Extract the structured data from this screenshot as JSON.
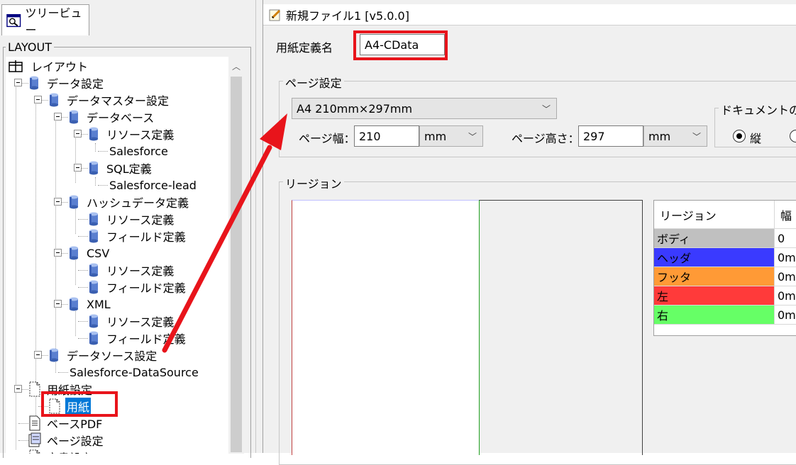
{
  "left": {
    "tab_label": "ツリービュー",
    "group_label": "LAYOUT",
    "tree": [
      {
        "label": "レイアウト",
        "icon": "layout-icon",
        "depth": 0
      },
      {
        "label": "データ設定",
        "icon": "database-icon",
        "depth": 1,
        "expanded": true
      },
      {
        "label": "データマスター設定",
        "icon": "database-icon",
        "depth": 2,
        "expanded": true
      },
      {
        "label": "データベース",
        "icon": "database-icon",
        "depth": 3,
        "expanded": true
      },
      {
        "label": "リソース定義",
        "icon": "database-icon",
        "depth": 4,
        "expanded": true
      },
      {
        "label": "Salesforce",
        "icon": "",
        "depth": 5
      },
      {
        "label": "SQL定義",
        "icon": "database-icon",
        "depth": 4,
        "expanded": true
      },
      {
        "label": "Salesforce-lead",
        "icon": "",
        "depth": 5
      },
      {
        "label": "ハッシュデータ定義",
        "icon": "database-icon",
        "depth": 3,
        "expanded": true
      },
      {
        "label": "リソース定義",
        "icon": "database-icon",
        "depth": 4
      },
      {
        "label": "フィールド定義",
        "icon": "database-icon",
        "depth": 4
      },
      {
        "label": "CSV",
        "icon": "database-icon",
        "depth": 3,
        "expanded": true
      },
      {
        "label": "リソース定義",
        "icon": "database-icon",
        "depth": 4
      },
      {
        "label": "フィールド定義",
        "icon": "database-icon",
        "depth": 4
      },
      {
        "label": "XML",
        "icon": "database-icon",
        "depth": 3,
        "expanded": true
      },
      {
        "label": "リソース定義",
        "icon": "database-icon",
        "depth": 4
      },
      {
        "label": "フィールド定義",
        "icon": "database-icon",
        "depth": 4
      },
      {
        "label": "データソース設定",
        "icon": "database-icon",
        "depth": 2,
        "expanded": true
      },
      {
        "label": "Salesforce-DataSource",
        "icon": "",
        "depth": 3
      },
      {
        "label": "用紙設定",
        "icon": "document-icon",
        "depth": 1,
        "expanded": true
      },
      {
        "label": "用紙",
        "icon": "document-icon",
        "depth": 2,
        "selected": true
      },
      {
        "label": "ベースPDF",
        "icon": "pdf-document-icon",
        "depth": 1
      },
      {
        "label": "ページ設定",
        "icon": "page-settings-icon",
        "depth": 1
      },
      {
        "label": "文書設定",
        "icon": "document-icon",
        "depth": 1
      }
    ]
  },
  "doc": {
    "title": "新規ファイル1 [v5.0.0]",
    "paper_name_label": "用紙定義名",
    "paper_name_value": "A4-CData",
    "page_settings": {
      "legend": "ページ設定",
      "size_selected": "A4 210mm×297mm",
      "width_label": "ページ幅：",
      "width_value": "210",
      "width_unit": "mm",
      "height_label": "ページ高さ：",
      "height_value": "297",
      "height_unit": "mm"
    },
    "orientation": {
      "legend": "ドキュメントの向",
      "portrait_label": "縦"
    },
    "region": {
      "legend": "リージョン",
      "columns": [
        "リージョン",
        "幅"
      ],
      "rows": [
        {
          "name": "ボディ",
          "value": "0",
          "color": "#c0c0c0"
        },
        {
          "name": "ヘッダ",
          "value": "0m",
          "color": "#3a3aff"
        },
        {
          "name": "フッタ",
          "value": "0m",
          "color": "#ff9a36"
        },
        {
          "name": "左",
          "value": "0m",
          "color": "#ff3a3a"
        },
        {
          "name": "右",
          "value": "0m",
          "color": "#66ff66"
        }
      ]
    }
  },
  "colors": {
    "highlight_red": "#e8141b",
    "selection_blue": "#0078d7"
  }
}
